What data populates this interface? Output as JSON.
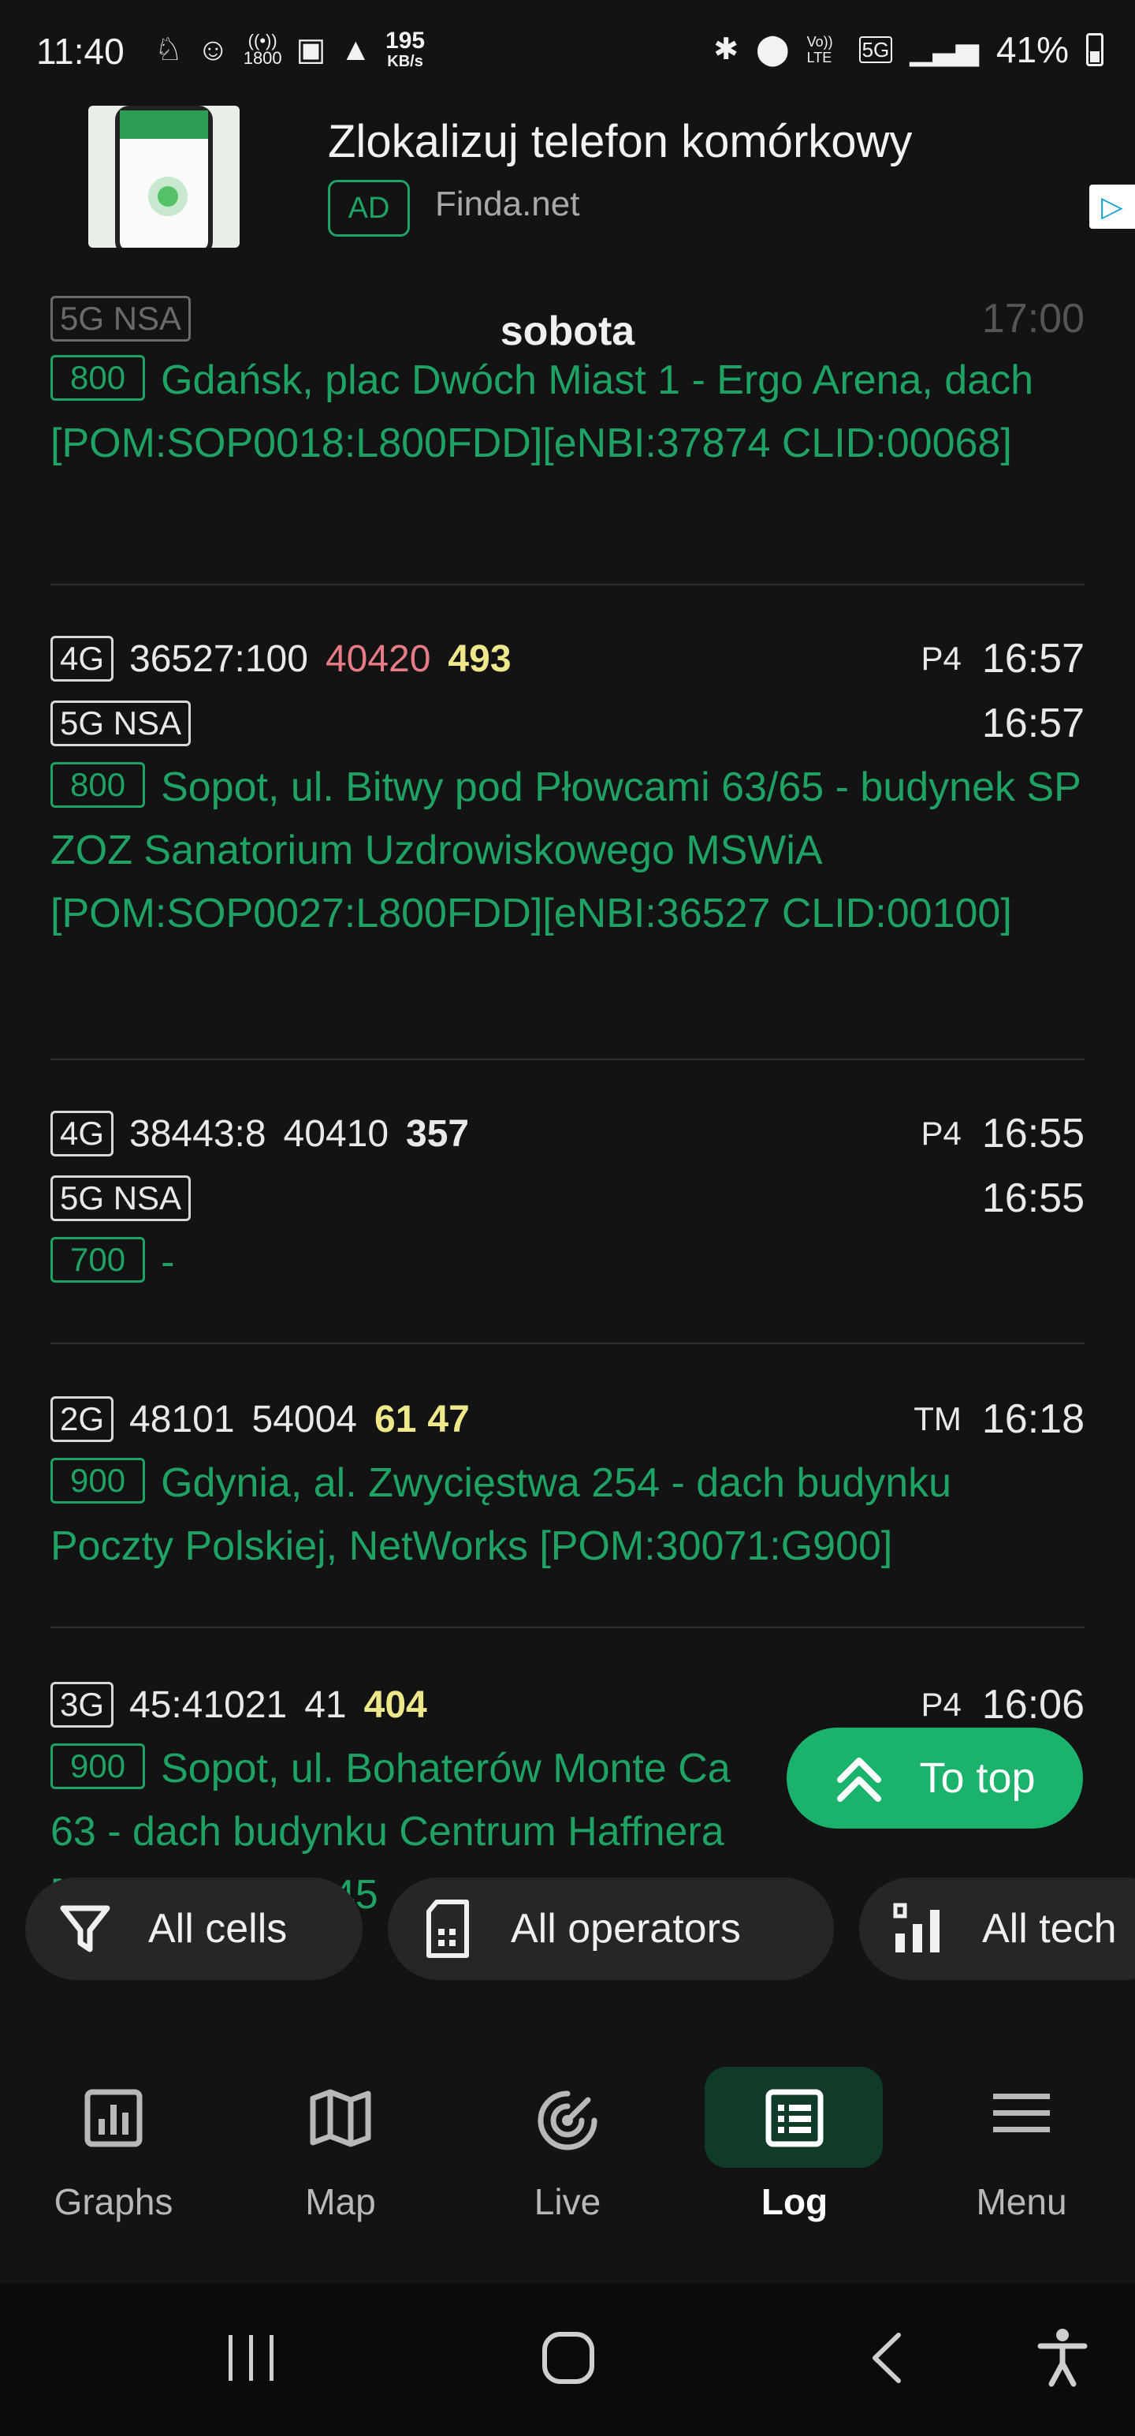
{
  "status_bar": {
    "time": "11:40",
    "speed_value": "195",
    "speed_unit": "KB/s",
    "data_counter": "1800",
    "volte": "Vo)) LTE",
    "network": "5G",
    "battery": "41%"
  },
  "ad": {
    "title": "Zlokalizuj telefon komórkowy",
    "badge": "AD",
    "source": "Finda.net",
    "choices_icon": "ad-choices-icon"
  },
  "log": {
    "entries": [
      {
        "tech_chip": "5G NSA",
        "time": "17:00",
        "day_label": "sobota",
        "band": "800",
        "site": "Gdańsk, plac Dwóch Miast 1 - Ergo Arena, dach [POM:SOP0018:L800FDD][eNBI:37874 CLID:00068]"
      },
      {
        "tech_chip": "4G",
        "cell": "36527:100",
        "code": "40420",
        "signal": "493",
        "operator": "P4",
        "time": "16:57",
        "sub_chip": "5G NSA",
        "sub_time": "16:57",
        "band": "800",
        "site": "Sopot, ul. Bitwy pod Płowcami 63/65 - budynek SP ZOZ Sanatorium Uzdrowiskowego MSWiA [POM:SOP0027:L800FDD][eNBI:36527 CLID:00100]"
      },
      {
        "tech_chip": "4G",
        "cell": "38443:8",
        "code": "40410",
        "signal": "357",
        "operator": "P4",
        "time": "16:55",
        "sub_chip": "5G NSA",
        "sub_time": "16:55",
        "band": "700",
        "site": "-"
      },
      {
        "tech_chip": "2G",
        "cell": "48101",
        "code": "54004",
        "signal": "61",
        "signal2": "47",
        "operator": "TM",
        "time": "16:18",
        "band": "900",
        "site": "Gdynia, al. Zwycięstwa 254 - dach budynku Poczty Polskiej, NetWorks [POM:30071:G900]"
      },
      {
        "tech_chip": "3G",
        "cell": "45:41021",
        "code": "41",
        "signal": "404",
        "operator": "P4",
        "time": "16:06",
        "band": "900",
        "site_line1": "Sopot, ul. Bohaterów Monte Ca",
        "site_line2": "63 - dach budynku Centrum Haffnera",
        "site_line3_partial": "[",
        "site_line3_tail": "3:45"
      }
    ]
  },
  "to_top": {
    "label": "To top",
    "icon": "double-chevron-up-icon"
  },
  "filters": [
    {
      "label": "All cells",
      "icon": "funnel-icon"
    },
    {
      "label": "All operators",
      "icon": "sim-card-icon"
    },
    {
      "label": "All tech",
      "icon": "signal-bars-icon"
    }
  ],
  "bottom_nav": [
    {
      "label": "Graphs",
      "icon": "bar-chart-icon"
    },
    {
      "label": "Map",
      "icon": "map-icon"
    },
    {
      "label": "Live",
      "icon": "radar-icon"
    },
    {
      "label": "Log",
      "icon": "list-icon",
      "active": true
    },
    {
      "label": "Menu",
      "icon": "hamburger-icon"
    }
  ],
  "colors": {
    "accent_green": "#1fa364",
    "button_green": "#1bb36c",
    "pink": "#e77b86",
    "yellow": "#efe88a",
    "background": "#131313"
  }
}
